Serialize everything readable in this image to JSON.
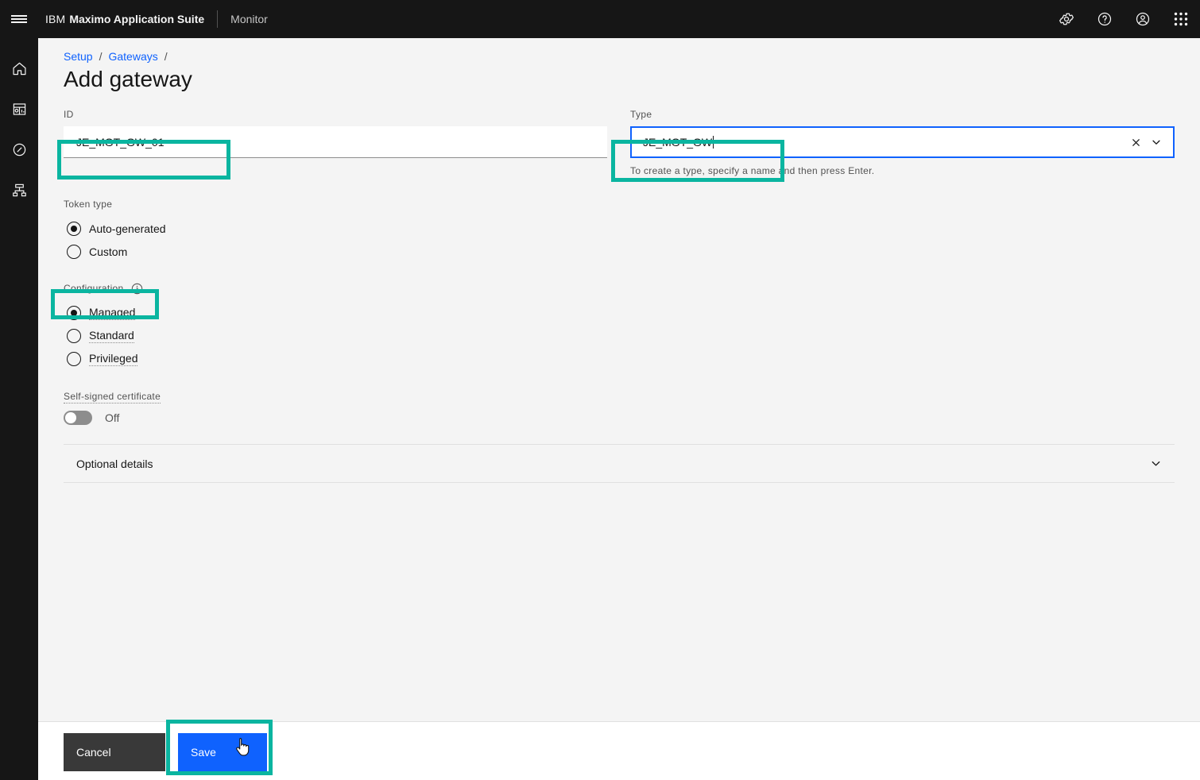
{
  "header": {
    "menu_label": "Open menu",
    "brand_prefix": "IBM",
    "brand_name": "Maximo Application Suite",
    "product": "Monitor",
    "icons": [
      "gear-icon",
      "help-icon",
      "user-avatar-icon",
      "app-switcher-icon"
    ]
  },
  "rail": {
    "items": [
      {
        "name": "home-icon",
        "label": "Home"
      },
      {
        "name": "dashboard-icon",
        "label": "Dashboards"
      },
      {
        "name": "explore-icon",
        "label": "Explore"
      },
      {
        "name": "devices-icon",
        "label": "Setup"
      }
    ]
  },
  "breadcrumb": {
    "items": [
      "Setup",
      "Gateways"
    ],
    "separator": "/"
  },
  "page": {
    "title": "Add gateway"
  },
  "form": {
    "id_field": {
      "label": "ID",
      "value": "JE_MGT_GW_01",
      "placeholder": ""
    },
    "type_field": {
      "label": "Type",
      "value": "JE_MGT_GW",
      "placeholder": "",
      "helper": "To create a type, specify a name and then press Enter.",
      "clear_icon": "close-icon",
      "chevron_icon": "chevron-down-icon"
    },
    "token_type": {
      "label": "Token type",
      "options": [
        {
          "label": "Auto-generated",
          "selected": true
        },
        {
          "label": "Custom",
          "selected": false
        }
      ]
    },
    "configuration": {
      "label": "Configuration",
      "info_icon": "information-icon",
      "options": [
        {
          "label": "Managed",
          "selected": true
        },
        {
          "label": "Standard",
          "selected": false
        },
        {
          "label": "Privileged",
          "selected": false
        }
      ]
    },
    "self_signed": {
      "label": "Self-signed certificate",
      "state_label": "Off",
      "on": false
    },
    "optional_details": {
      "label": "Optional details",
      "expanded": false,
      "chevron_icon": "chevron-down-icon"
    }
  },
  "footer": {
    "cancel_label": "Cancel",
    "save_label": "Save"
  },
  "annotations": {
    "highlight_color": "#0ab5a0",
    "accent_blue": "#0f62fe",
    "cursor": "pointer-hand"
  }
}
